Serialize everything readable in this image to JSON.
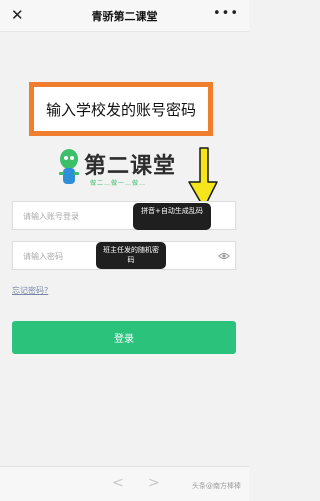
{
  "header": {
    "title": "青骄第二课堂",
    "close_icon": "close-icon",
    "more_icon": "more-dots-icon"
  },
  "banner": {
    "text": "输入学校发的账号密码",
    "border_color": "#f07e2f"
  },
  "logo": {
    "title": "第二课堂",
    "slogan": "做二…做一…做…"
  },
  "form": {
    "account_placeholder": "请输入账号登录",
    "password_placeholder": "请输入密码",
    "account_hint": "拼音+自动生成乱码",
    "password_hint": "班主任发的随机密码",
    "forgot_label": "忘记密码?",
    "login_label": "登录",
    "accent": "#2bc27c"
  },
  "navbar": {
    "back_icon": "back-chevron-icon",
    "forward_icon": "forward-chevron-icon"
  },
  "watermark": "头条@南方棒棒"
}
